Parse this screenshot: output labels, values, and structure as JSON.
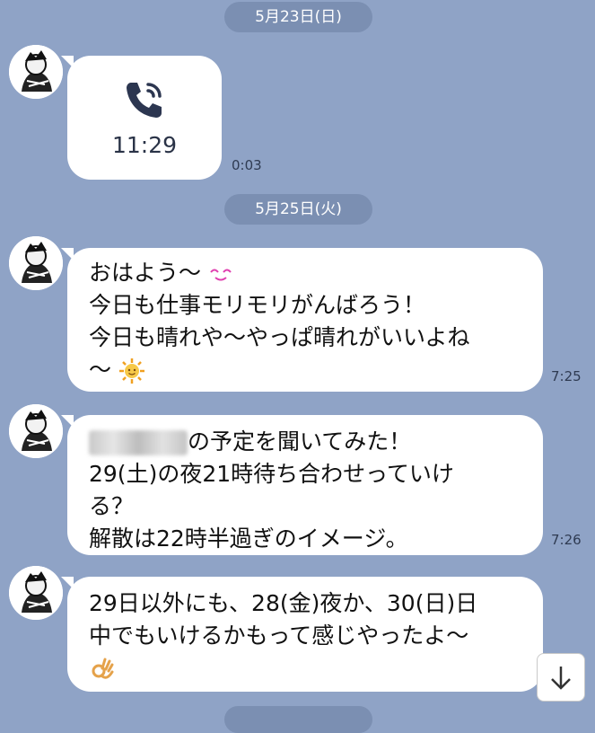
{
  "dates": {
    "first": "5月23日(日)",
    "second": "5月25日(火)"
  },
  "call": {
    "time": "11:29",
    "duration": "0:03"
  },
  "messages": [
    {
      "line1": "おはよう〜",
      "line2": "今日も仕事モリモリがんばろう！",
      "line3": "今日も晴れや〜やっぱ晴れがいいよね",
      "line4": "〜",
      "time": "7:25"
    },
    {
      "line1": "の予定を聞いてみた！",
      "line2": "29(土)の夜21時待ち合わせっていけ",
      "line3": "る？",
      "line4": "解散は22時半過ぎのイメージ。",
      "time": "7:26"
    },
    {
      "line1": "29日以外にも、28(金)夜か、30(日)日",
      "line2": "中でもいけるかもって感じやったよ〜"
    }
  ],
  "icons": {
    "phone": "phone-icon",
    "smile": "smile-emoji-icon",
    "sun": "sun-emoji-icon",
    "ok": "ok-hand-emoji-icon",
    "scroll": "arrow-down-icon"
  },
  "colors": {
    "background": "#8fa3c6",
    "date_pill": "#7b8fb2",
    "bubble": "#ffffff"
  }
}
